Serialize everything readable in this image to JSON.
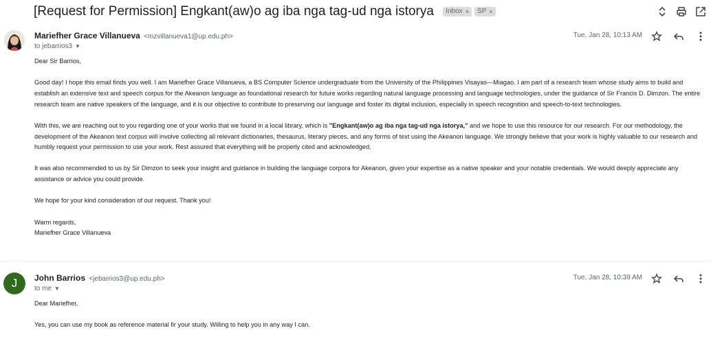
{
  "thread": {
    "subject": "[Request for Permission] Engkant(aw)o ag iba nga tag-ud nga istorya",
    "labels": [
      "Inbox",
      "SP"
    ],
    "actions": {
      "expand_icon": "unfold-icon",
      "print_icon": "print-icon",
      "open_new_window_icon": "open-in-new-icon"
    }
  },
  "messages": [
    {
      "sender_name": "Mariefher Grace Villanueva",
      "sender_email": "<mzvillanueva1@up.edu.ph>",
      "to": "to jebarrios3",
      "time": "Tue, Jan 28, 10:13 AM",
      "greeting": "Dear Sir Barrios,",
      "p1": "Good day! I hope this email finds you well. I am Mariefher Grace Villanueva, a BS Computer Science undergraduate from the University of the Philippines Visayas—Miagao. I am part of a research team whose study aims to build and establish an extensive text and speech corpus for the Akeanon language as foundational research for future works regarding natural language processing and language technologies, under the guidance of Sir Francis D. Dimzon. The entire research team are native speakers of the language, and it is our objective to contribute to preserving our language and foster its digital inclusion, especially in speech recognition and speech-to-text technologies.",
      "p2_before": "With this, we are reaching out to you regarding one of your works that we found in a local library, which is ",
      "p2_bold": "\"Engkant(aw)o ag iba nga tag-ud nga istorya,\"",
      "p2_after": " and we hope to use this resource for our research. For our methodology, the development of the Akeanon text corpus will involve collecting all relevant dictionaries, thesaurus, literary pieces, and any forms of text using the Akeanon language. We strongly believe that your work is highly valuable to our research and humbly request your permission to use your work. Rest assured that everything will be properly cited and acknowledged.",
      "p3": "It was also recommended to us by Sir Dimzon to seek your insight and guidance in building the language corpora for Akeanon, given your expertise as a native speaker and your notable credentials. We would deeply appreciate any assistance or advice you could provide.",
      "p4": "We hope for your kind consideration of our request. Thank you!",
      "closing": "Warm regards,",
      "signature": "Mariefher Grace Villanueva"
    },
    {
      "sender_name": "John Barrios",
      "sender_email": "<jebarrios3@up.edu.ph>",
      "avatar_letter": "J",
      "to": "to me",
      "time": "Tue, Jan 28, 10:39 AM",
      "greeting": "Dear Mariefher,",
      "p1": "Yes, you can use my book as reference material fir your study. Willing to help you in any way I can."
    }
  ],
  "colors": {
    "avatar_j": "#33691e",
    "label_chip_bg": "#dddddd",
    "meta_text": "#5f6368"
  }
}
